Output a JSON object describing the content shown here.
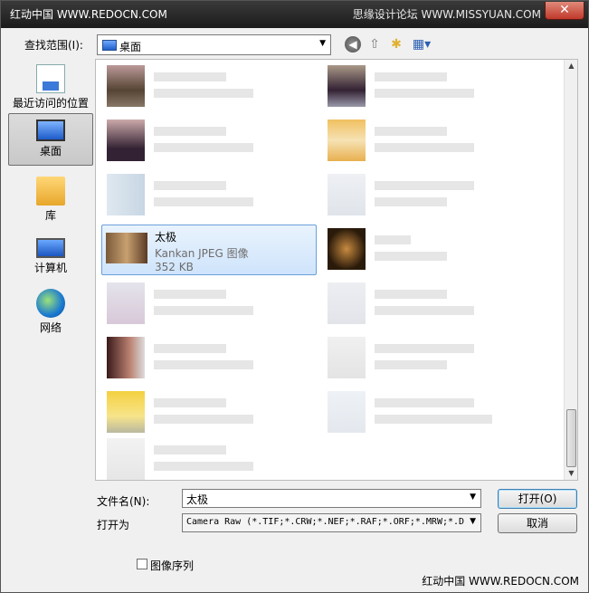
{
  "window": {
    "title": "红动中国 WWW.REDOCN.COM",
    "watermark_right": "思缘设计论坛 WWW.MISSYUAN.COM",
    "close_glyph": "✕",
    "app_icon_glyph": "Ps"
  },
  "lookin": {
    "label": "查找范围(I):",
    "value": "桌面",
    "arrow": "▼"
  },
  "toolbar": {
    "back_glyph": "◀",
    "up_glyph": "⇧",
    "newfolder_glyph": "✱",
    "views_glyph": "▦▾"
  },
  "places": [
    {
      "label": "最近访问的位置"
    },
    {
      "label": "桌面"
    },
    {
      "label": "库"
    },
    {
      "label": "计算机"
    },
    {
      "label": "网络"
    }
  ],
  "selected_file": {
    "name": "太极",
    "type": "Kankan JPEG 图像",
    "size": "352 KB"
  },
  "scrollbar": {
    "up": "▲",
    "down": "▼"
  },
  "filename": {
    "label": "文件名(N):",
    "value": "太极",
    "arrow": "▼"
  },
  "filetype": {
    "label": "打开为",
    "value": "Camera Raw (*.TIF;*.CRW;*.NEF;*.RAF;*.ORF;*.MRW;*.D",
    "arrow": "▼"
  },
  "buttons": {
    "open": "打开(O)",
    "cancel": "取消"
  },
  "sequence": {
    "label": "图像序列"
  },
  "watermark_bottom": "红动中国 WWW.REDOCN.COM",
  "colors": {
    "selection_border": "#6aa0da",
    "selection_fill": "#cfe4fb",
    "titlebar": "#1c1c1c"
  }
}
